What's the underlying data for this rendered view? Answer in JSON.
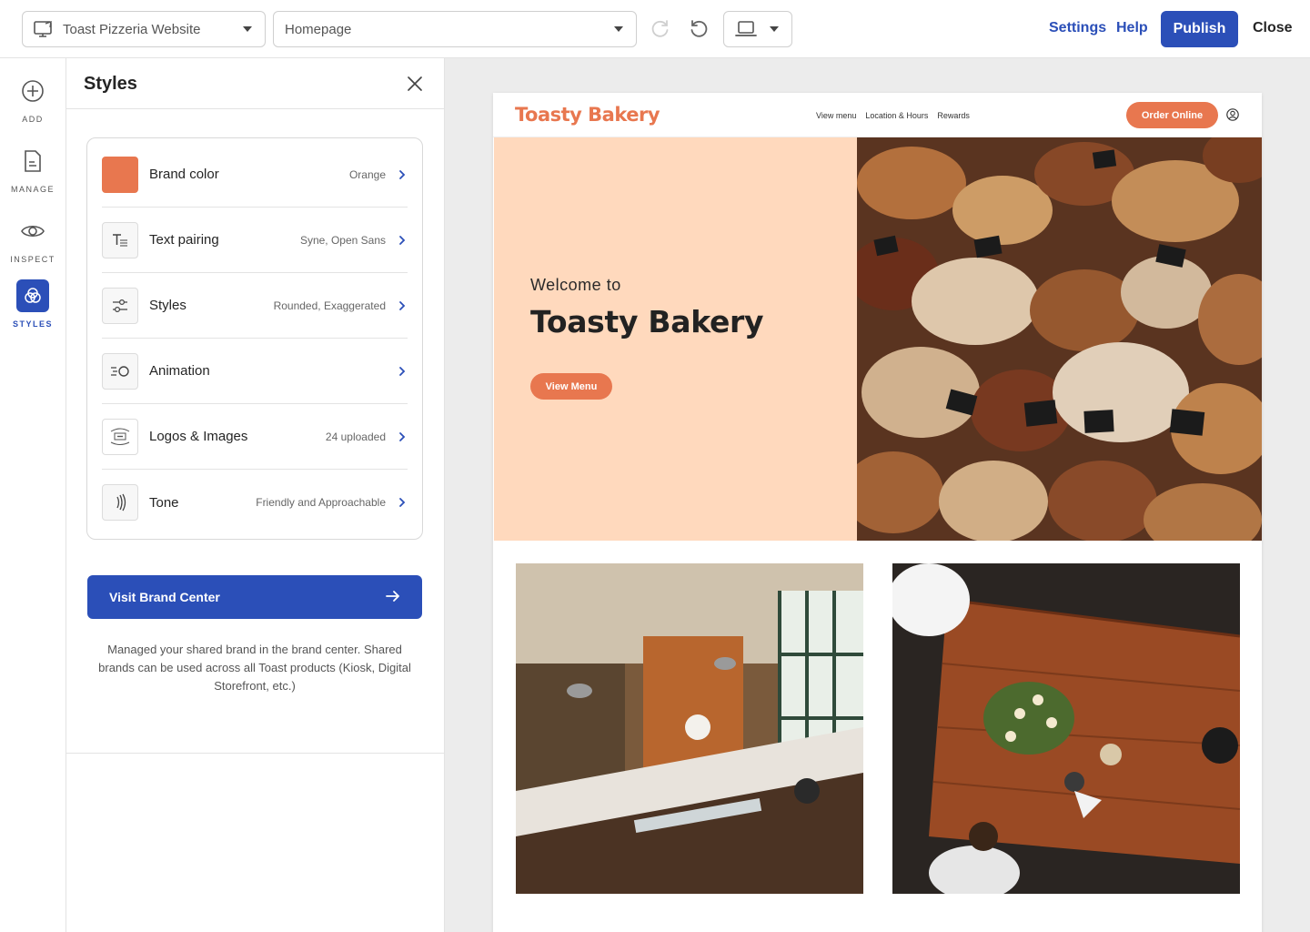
{
  "topbar": {
    "site_select": "Toast Pizzeria Website",
    "page_select": "Homepage",
    "settings": "Settings",
    "help": "Help",
    "publish": "Publish",
    "close": "Close"
  },
  "rail": {
    "items": [
      {
        "label": "ADD",
        "icon": "plus-circle-icon"
      },
      {
        "label": "MANAGE",
        "icon": "document-icon"
      },
      {
        "label": "INSPECT",
        "icon": "eye-icon"
      },
      {
        "label": "STYLES",
        "icon": "styles-circles-icon",
        "active": true
      }
    ]
  },
  "panel": {
    "title": "Styles",
    "rows": [
      {
        "name": "Brand color",
        "value": "Orange",
        "swatch": "#e8774f"
      },
      {
        "name": "Text pairing",
        "value": "Syne, Open Sans"
      },
      {
        "name": "Styles",
        "value": "Rounded, Exaggerated"
      },
      {
        "name": "Animation",
        "value": ""
      },
      {
        "name": "Logos & Images",
        "value": "24 uploaded"
      },
      {
        "name": "Tone",
        "value": "Friendly and Approachable"
      }
    ],
    "brand_button": "Visit Brand Center",
    "brand_note": "Managed your shared brand in the brand center. Shared brands can be used across all Toast products (Kiosk, Digital Storefront, etc.)"
  },
  "site": {
    "logo": "Toasty Bakery",
    "nav_links": [
      "View menu",
      "Location & Hours",
      "Rewards"
    ],
    "order_button": "Order Online",
    "welcome": "Welcome to",
    "hero_title": "Toasty Bakery",
    "hero_button": "View Menu"
  },
  "colors": {
    "accent": "#2b4fb8",
    "brand": "#e8774f",
    "hero_bg": "#ffd9bd"
  }
}
